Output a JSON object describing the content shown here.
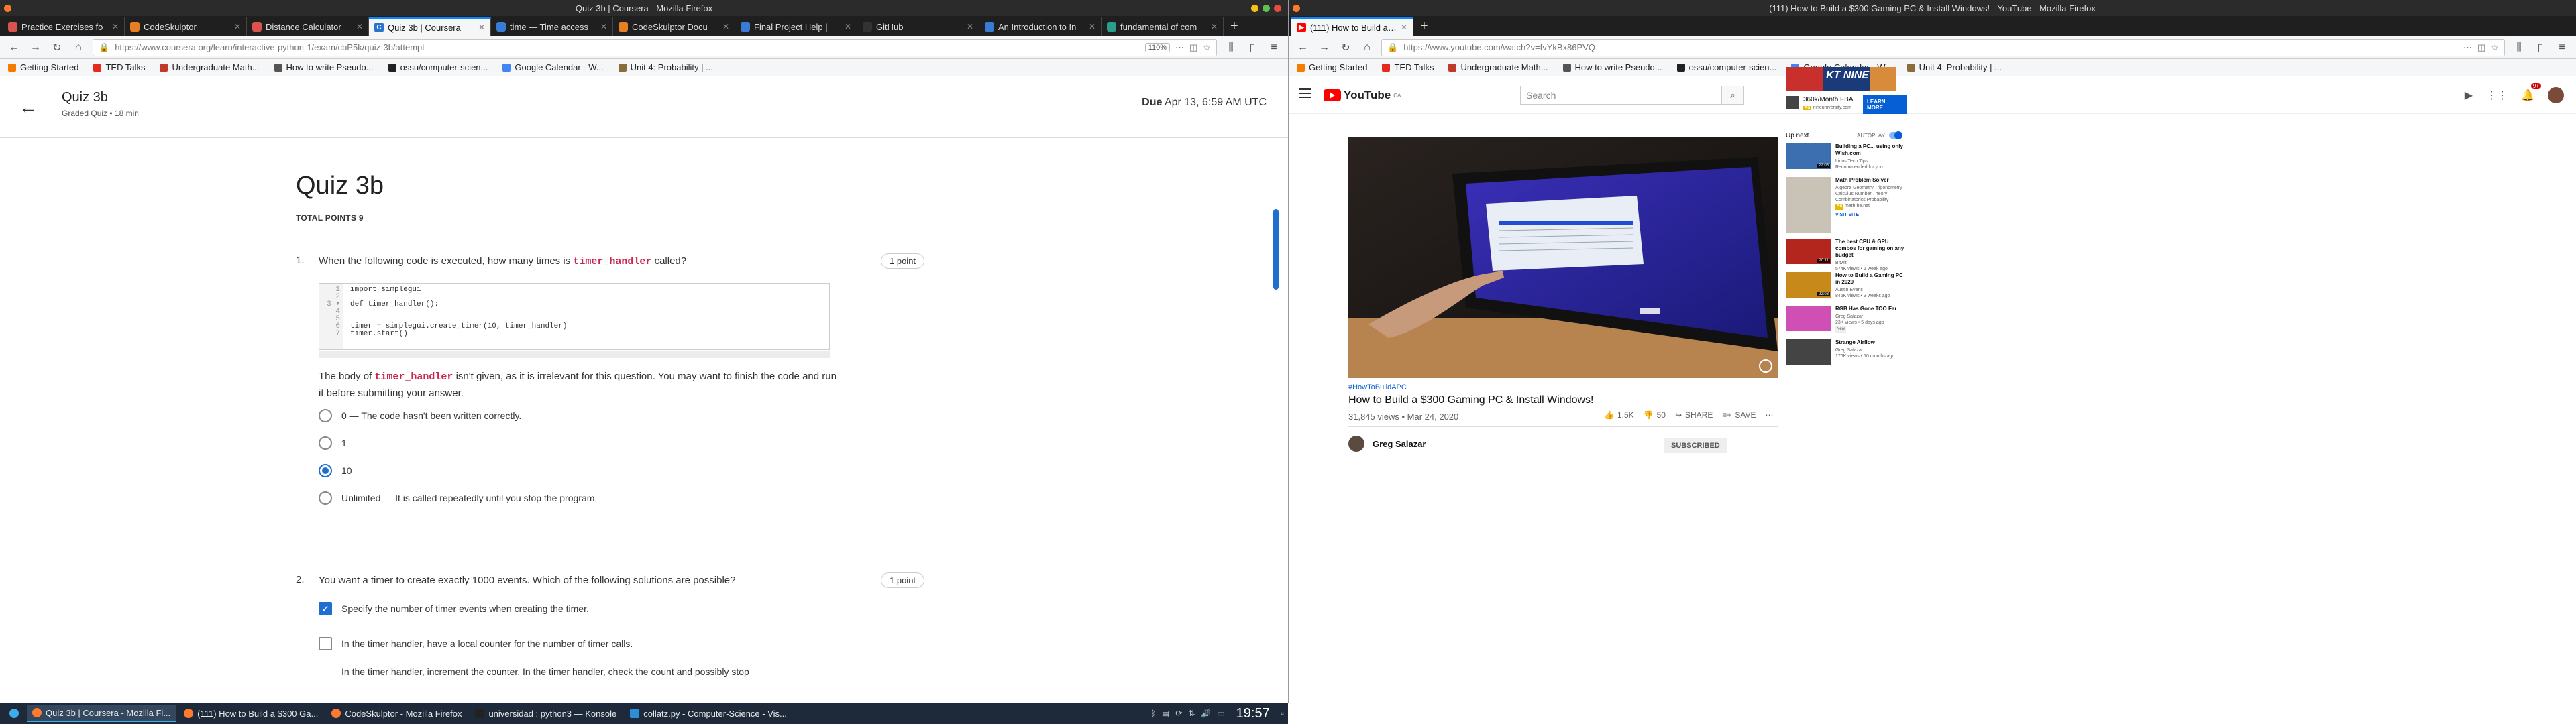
{
  "left": {
    "window_title": "Quiz 3b | Coursera - Mozilla Firefox",
    "tabs": [
      {
        "label": "Practice Exercises fo",
        "color": "#d9534f"
      },
      {
        "label": "CodeSkulptor",
        "color": "#e67e22"
      },
      {
        "label": "Distance Calculator",
        "color": "#d9534f"
      },
      {
        "label": "Quiz 3b | Coursera",
        "color": "#2a73cc",
        "active": true
      },
      {
        "label": "time — Time access",
        "color": "#3a7bd5"
      },
      {
        "label": "CodeSkulptor Docu",
        "color": "#e67e22"
      },
      {
        "label": "Final Project Help |",
        "color": "#3a7bd5"
      },
      {
        "label": "GitHub",
        "color": "#333333"
      },
      {
        "label": "An Introduction to In",
        "color": "#3a7bd5"
      },
      {
        "label": "fundamental of com",
        "color": "#2a9d8f"
      }
    ],
    "url": "https://www.coursera.org/learn/interactive-python-1/exam/cbP5k/quiz-3b/attempt",
    "zoom": "110%",
    "bookmarks": [
      "Getting Started",
      "TED Talks",
      "Undergraduate Math...",
      "How to write Pseudo...",
      "ossu/computer-scien...",
      "Google Calendar - W...",
      "Unit 4: Probability | ..."
    ],
    "header": {
      "title": "Quiz 3b",
      "subtitle": "Graded Quiz • 18 min",
      "due_label": "Due",
      "due_value": "Apr 13, 6:59 AM UTC"
    },
    "page_title": "Quiz 3b",
    "total_points": "TOTAL POINTS 9",
    "q1": {
      "number": "1.",
      "text_before": "When the following code is executed, how many times is",
      "code_term": "timer_handler",
      "text_after": "called?",
      "points": "1 point",
      "line_numbers": "1\n2\n3 ▾\n4\n5\n6\n7",
      "code": "import simplegui\n\ndef timer_handler():\n\n\ntimer = simplegui.create_timer(10, timer_handler)\ntimer.start()",
      "body_pre": "The body of",
      "body_term": "timer_handler",
      "body_post": "isn't given, as it is irrelevant for this question. You may want to finish the code and run it before submitting your answer.",
      "options": [
        {
          "label": "0 — The code hasn't been written correctly.",
          "selected": false
        },
        {
          "label": "1",
          "selected": false
        },
        {
          "label": "10",
          "selected": true
        },
        {
          "label": "Unlimited — It is called repeatedly until you stop the program.",
          "selected": false
        }
      ]
    },
    "q2": {
      "number": "2.",
      "text": "You want a timer to create exactly 1000 events. Which of the following solutions are possible?",
      "points": "1 point",
      "options": [
        {
          "label": "Specify the number of timer events when creating the timer.",
          "checked": true
        },
        {
          "label": "In the timer handler, have a local counter for the number of timer calls.",
          "checked": false
        },
        {
          "label": "In the timer handler, increment the counter. In the timer handler, check the count and possibly stop",
          "checked": false
        }
      ]
    }
  },
  "right": {
    "window_title": "(111) How to Build a $300 Gaming PC & Install Windows! - YouTube - Mozilla Firefox",
    "tab": "(111) How to Build a $3",
    "url": "https://www.youtube.com/watch?v=fvYkBx86PVQ",
    "bookmarks": [
      "Getting Started",
      "TED Talks",
      "Undergraduate Math...",
      "How to write Pseudo...",
      "ossu/computer-scien...",
      "Google Calendar - W...",
      "Unit 4: Probability | ..."
    ],
    "logo": "YouTube",
    "logo_country": "CA",
    "search_placeholder": "Search",
    "notifications": "9+",
    "video": {
      "hashtag": "#HowToBuildAPC",
      "title": "How to Build a $300 Gaming PC & Install Windows!",
      "views": "31,845 views • Mar 24, 2020",
      "likes": "1.5K",
      "dislikes": "50",
      "share": "SHARE",
      "save": "SAVE",
      "channel": "Greg Salazar",
      "subscribed": "SUBSCRIBED"
    },
    "ad": {
      "banner": "KT NINE",
      "title": "360k/Month FBA",
      "badge": "Ad",
      "domain": "nineuniversity.com",
      "cta": "LEARN MORE"
    },
    "up_next": "Up next",
    "autoplay": "AUTOPLAY",
    "recommendations": [
      {
        "title": "Building a PC... using only Wish.com",
        "channel": "Linus Tech Tips",
        "meta": "Recommended for you",
        "duration": "22:05",
        "color": "#3b6fb0"
      },
      {
        "title": "Math Problem Solver",
        "channel": "Algebra Geometry Trigonometry Calculus Number Theory Combinatorics Probability",
        "meta": "math.he.net",
        "duration": "",
        "cta": "VISIT SITE",
        "color": "#c9c2b6"
      },
      {
        "title": "The best CPU & GPU combos for gaming on any budget",
        "channel": "Bitwit",
        "meta": "574K views • 1 week ago",
        "duration": "20:11",
        "color": "#b3261e"
      },
      {
        "title": "How to Build a Gaming PC in 2020",
        "channel": "Austin Evans",
        "meta": "845K views • 3 weeks ago",
        "duration": "22:03",
        "color": "#c78a1a"
      },
      {
        "title": "RGB Has Gone TOO Far",
        "channel": "Greg Salazar",
        "meta": "23K views • 5 days ago",
        "badge": "New",
        "duration": "",
        "color": "#d04fb5"
      },
      {
        "title": "Strange Airflow",
        "channel": "Greg Salazar",
        "meta": "176K views • 10 months ago",
        "duration": "",
        "color": "#444"
      }
    ]
  },
  "taskbar": {
    "items": [
      "Quiz 3b | Coursera - Mozilla Fi...",
      "(111) How to Build a $300 Ga...",
      "CodeSkulptor - Mozilla Firefox",
      "universidad : python3 — Konsole",
      "collatz.py - Computer-Science - Vis..."
    ],
    "clock": "19:57"
  }
}
